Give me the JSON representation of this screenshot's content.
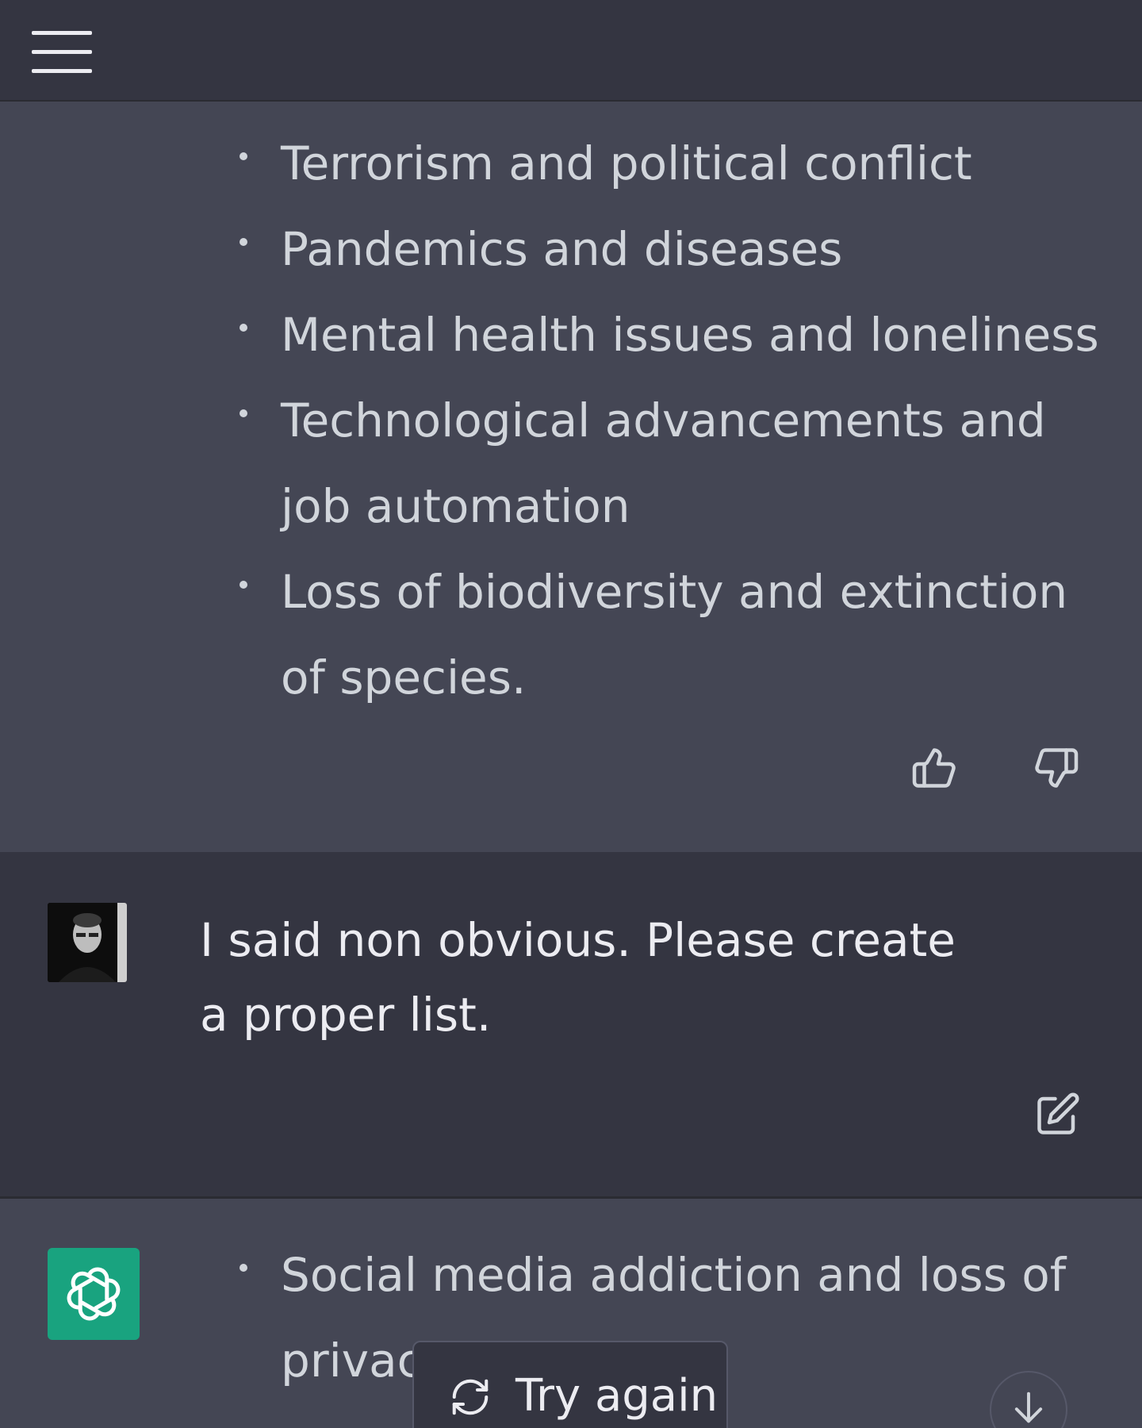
{
  "header": {
    "menu_icon": "hamburger-menu-icon"
  },
  "assistant_message_1": {
    "items": [
      "Terrorism and political conflict",
      "Pandemics and diseases",
      "Mental health issues and loneliness",
      "Technological advancements and job automation",
      "Loss of biodiversity and extinction of species."
    ],
    "feedback_icons": [
      "thumbs-up-icon",
      "thumbs-down-icon"
    ]
  },
  "user_message": {
    "text": "I said non obvious. Please create a proper list.",
    "avatar_icon": "user-avatar",
    "edit_icon": "edit-icon"
  },
  "assistant_message_2": {
    "logo_icon": "openai-logo-icon",
    "items": [
      "Social media addiction and loss of privac"
    ]
  },
  "try_again": {
    "label": "Try again",
    "icon": "refresh-icon"
  },
  "scroll_button": {
    "icon": "arrow-down-icon"
  },
  "colors": {
    "background": "#343541",
    "assistant_background": "#444654",
    "logo_green": "#19a37f",
    "text": "#d1d5db"
  }
}
